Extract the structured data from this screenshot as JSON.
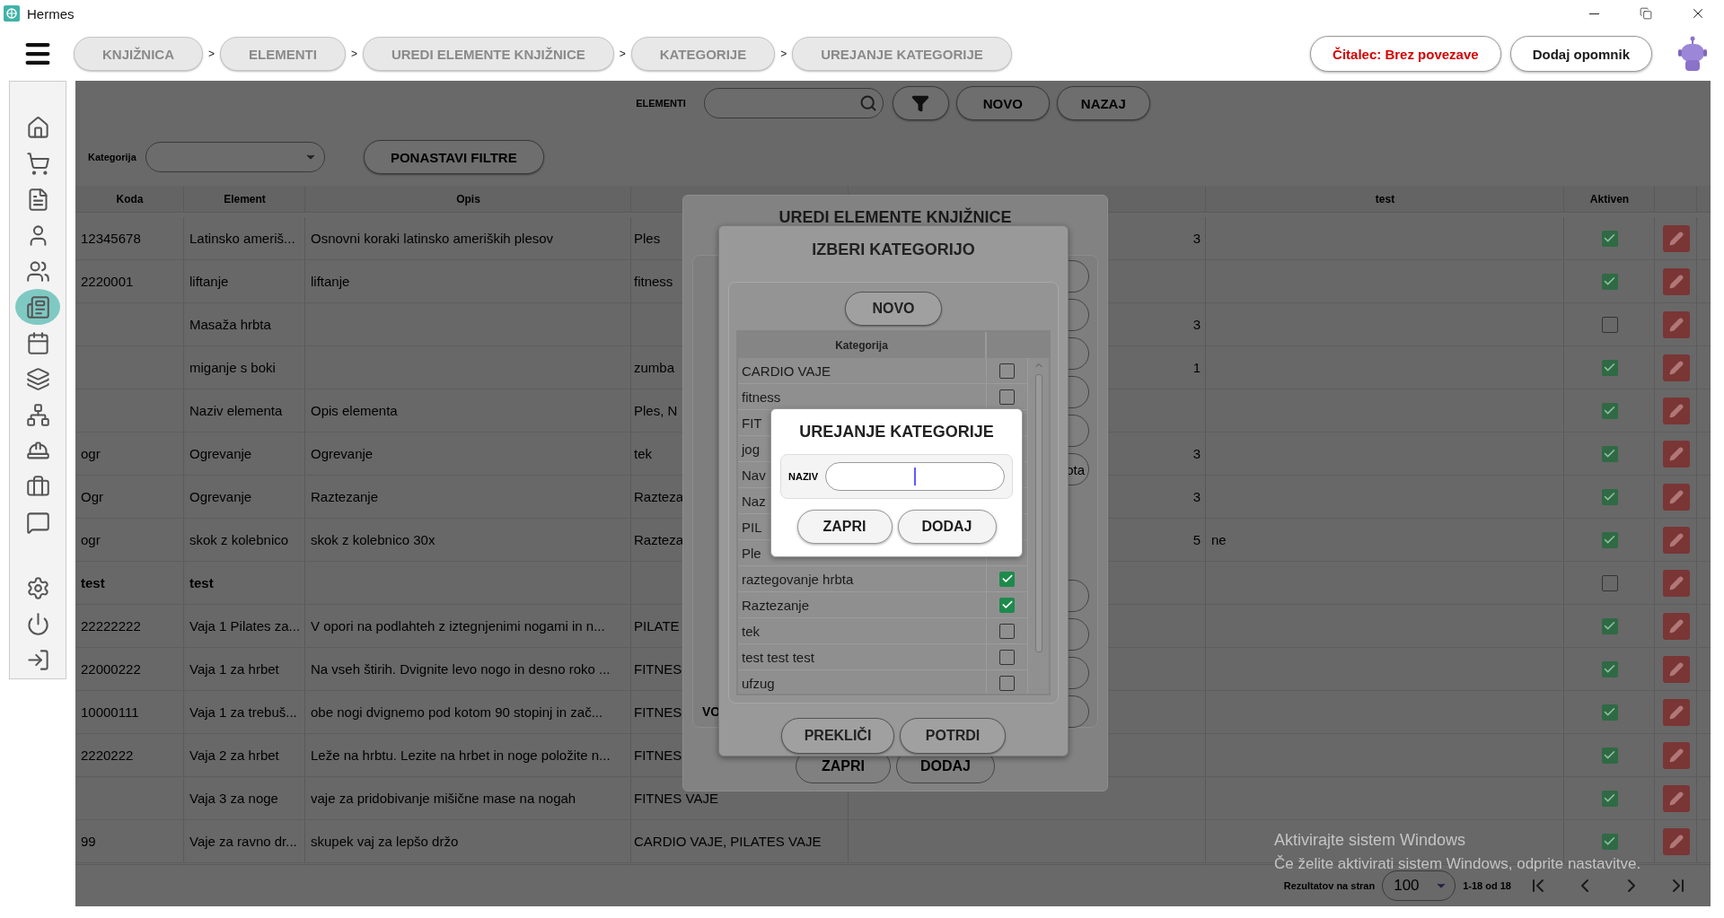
{
  "window": {
    "title": "Hermes"
  },
  "breadcrumbs": [
    {
      "label": "KNJIŽNICA",
      "separator": ">"
    },
    {
      "label": "ELEMENTI",
      "separator": ">"
    },
    {
      "label": "UREDI ELEMENTE KNJIŽNICE",
      "separator": ">"
    },
    {
      "label": "KATEGORIJE",
      "separator": ">"
    },
    {
      "label": "UREJANJE KATEGORIJE"
    }
  ],
  "header_buttons": [
    {
      "label": "Čitalec: Brez povezave",
      "kind": "status"
    },
    {
      "label": "Dodaj opomnik",
      "kind": "action"
    }
  ],
  "sidebar": {
    "items": [
      {
        "kind": "home",
        "selected": false
      },
      {
        "kind": "cart",
        "selected": false
      },
      {
        "kind": "document",
        "selected": false
      },
      {
        "kind": "user",
        "selected": false
      },
      {
        "kind": "users",
        "selected": false
      },
      {
        "kind": "library",
        "selected": true
      },
      {
        "kind": "calendar",
        "selected": false
      },
      {
        "kind": "layers",
        "selected": false
      },
      {
        "kind": "network",
        "selected": false
      },
      {
        "kind": "worker",
        "selected": false
      },
      {
        "kind": "briefcase",
        "selected": false
      },
      {
        "kind": "message",
        "selected": false
      }
    ],
    "bottom_items": [
      {
        "kind": "settings",
        "selected": false
      },
      {
        "kind": "power",
        "selected": false
      },
      {
        "kind": "exit",
        "selected": false
      }
    ]
  },
  "toolbar": {
    "label": "ELEMENTI",
    "buttons": [
      "NOVO",
      "NAZAJ"
    ]
  },
  "filters": {
    "label": "Kategorija",
    "button": "PONASTAVI FILTRE"
  },
  "table": {
    "headers": {
      "koda": "Koda",
      "element": "Element",
      "opis": "Opis",
      "test": "test",
      "aktiven": "Aktiven"
    },
    "rows": [
      {
        "koda": "12345678",
        "element": "Latinsko ameriš...",
        "opis": "Osnovni koraki latinsko ameriških plesov",
        "column_4": "Ples",
        "column_5": "3",
        "active": true,
        "selected": false
      },
      {
        "koda": "2220001",
        "element": "liftanje",
        "opis": "liftanje",
        "column_4": "fitness",
        "active": true,
        "selected": false
      },
      {
        "element": "Masaža hrbta",
        "column_5": "3",
        "active": false,
        "selected": false
      },
      {
        "element": "miganje s boki",
        "column_4": "zumba",
        "column_5": "1",
        "active": true,
        "selected": false
      },
      {
        "element": "Naziv elementa",
        "opis": "Opis elementa",
        "column_4": "Ples, N",
        "active": true,
        "selected": false
      },
      {
        "koda": "ogr",
        "element": "Ogrevanje",
        "opis": "Ogrevanje",
        "column_4": "tek",
        "column_5": "3",
        "active": true,
        "selected": false
      },
      {
        "koda": "Ogr",
        "element": "Ogrevanje",
        "opis": "Raztezanje",
        "column_4": "Razteza",
        "column_5": "3",
        "active": true,
        "selected": false
      },
      {
        "koda": "ogr",
        "element": "skok z kolebnico",
        "opis": "skok z kolebnico 30x",
        "column_4": "Razteza",
        "column_5": "5",
        "test": "ne",
        "active": true,
        "selected": false
      },
      {
        "koda": "test",
        "element": "test",
        "active": false,
        "selected": true
      },
      {
        "koda": "22222222",
        "element": "Vaja 1 Pilates za...",
        "opis": "V opori na podlahteh z iztegnjenimi nogami in n...",
        "column_4": "PILATE",
        "active": true,
        "selected": false
      },
      {
        "koda": "22000222",
        "element": "Vaja 1 za hrbet",
        "opis": "Na vseh štirih. Dvignite levo nogo in desno roko ...",
        "column_4": "FITNES",
        "active": true,
        "selected": false
      },
      {
        "koda": "10000111",
        "element": "Vaja 1 za trebuš...",
        "opis": "obe nogi dvignemo pod kotom 90 stopinj in zač...",
        "column_4": "FITNES",
        "active": true,
        "selected": false
      },
      {
        "koda": "2220222",
        "element": "Vaja 2 za hrbet",
        "opis": "Leže na hrbtu. Lezite na hrbet in noge položite n...",
        "column_4": "FITNES",
        "active": true,
        "selected": false
      },
      {
        "element": "Vaja 3 za noge",
        "opis": "vaje za pridobivanje mišične mase na nogah",
        "column_4": "FITNES VAJE",
        "active": true,
        "selected": false
      },
      {
        "koda": "99",
        "element": "Vaje za ravno dr...",
        "opis": "skupek vaj za lepšo držo",
        "column_4": "CARDIO VAJE, PILATES VAJE",
        "active": true,
        "selected": false
      }
    ]
  },
  "pagination": {
    "label": "Rezultatov na stran",
    "page_size": "100",
    "range": "1-18 od 18"
  },
  "os_notice": {
    "title": "Aktivirajte sistem Windows",
    "text": "Če želite aktivirati sistem Windows, odprite nastavitve."
  },
  "library_dialog": {
    "title": "UREDI ELEMENTE KNJIŽNICE",
    "fields": [
      {
        "kind": "input"
      },
      {
        "kind": "input"
      },
      {
        "kind": "input"
      },
      {
        "kind": "input"
      },
      {
        "kind": "input"
      },
      {
        "kind": "input",
        "value": "ota"
      },
      {
        "kind": "spacer"
      },
      {
        "kind": "input"
      },
      {
        "kind": "input"
      },
      {
        "kind": "input"
      },
      {
        "kind": "input",
        "label": "VO"
      }
    ],
    "buttons": [
      "ZAPRI",
      "DODAJ"
    ]
  },
  "category_dialog": {
    "title": "IZBERI KATEGORIJO",
    "new_button": "NOVO",
    "column": "Kategorija",
    "items": [
      {
        "name": "CARDIO VAJE",
        "checked": false
      },
      {
        "name": "fitness",
        "checked": false
      },
      {
        "name": "FIT"
      },
      {
        "name": "jog"
      },
      {
        "name": "Nav"
      },
      {
        "name": "Naz"
      },
      {
        "name": "PIL"
      },
      {
        "name": "Ple"
      },
      {
        "name": "raztegovanje hrbta",
        "checked": true
      },
      {
        "name": "Raztezanje",
        "checked": true
      },
      {
        "name": "tek",
        "checked": false
      },
      {
        "name": "test test test",
        "checked": false
      },
      {
        "name": "ufzug",
        "checked": false
      }
    ],
    "buttons": [
      "PREKLIČI",
      "POTRDI"
    ]
  },
  "edit_dialog": {
    "title": "UREJANJE KATEGORIJE",
    "field_label": "NAZIV",
    "buttons": [
      "ZAPRI",
      "DODAJ"
    ]
  }
}
